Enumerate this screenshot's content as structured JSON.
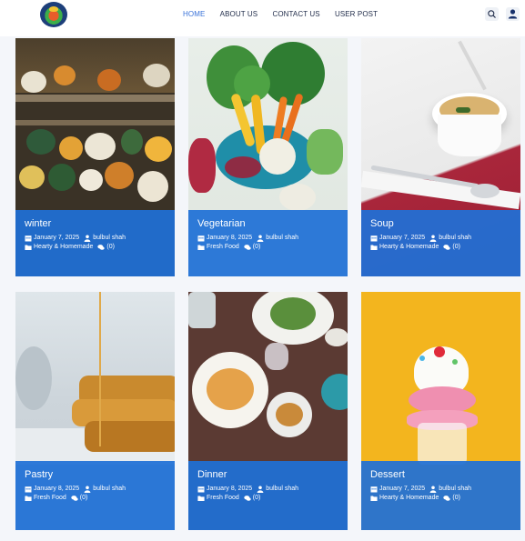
{
  "nav": {
    "items": [
      {
        "label": "HOME",
        "active": true
      },
      {
        "label": "ABOUT US",
        "active": false
      },
      {
        "label": "CONTACT US",
        "active": false
      },
      {
        "label": "USER POST",
        "active": false
      }
    ]
  },
  "header_icons": [
    "search-icon",
    "user-icon"
  ],
  "colors": {
    "accent": "#3b73d9",
    "overlay": "#1f70d6",
    "nav_text": "#1f2b49",
    "page_bg": "#f4f6fa"
  },
  "cards": [
    {
      "title": "winter",
      "date": "January 7, 2025",
      "author": "bulbul shah",
      "category": "Hearty & Homemade",
      "comments": "(0)"
    },
    {
      "title": "Vegetarian",
      "date": "January 8, 2025",
      "author": "bulbul shah",
      "category": "Fresh Food",
      "comments": "(0)"
    },
    {
      "title": "Soup",
      "date": "January 7, 2025",
      "author": "bulbul shah",
      "category": "Hearty & Homemade",
      "comments": "(0)"
    },
    {
      "title": "Pastry",
      "date": "January 8, 2025",
      "author": "bulbul shah",
      "category": "Fresh Food",
      "comments": "(0)"
    },
    {
      "title": "Dinner",
      "date": "January 8, 2025",
      "author": "bulbul shah",
      "category": "Fresh Food",
      "comments": "(0)"
    },
    {
      "title": "Dessert",
      "date": "January 7, 2025",
      "author": "bulbul shah",
      "category": "Hearty & Homemade",
      "comments": "(0)"
    }
  ]
}
